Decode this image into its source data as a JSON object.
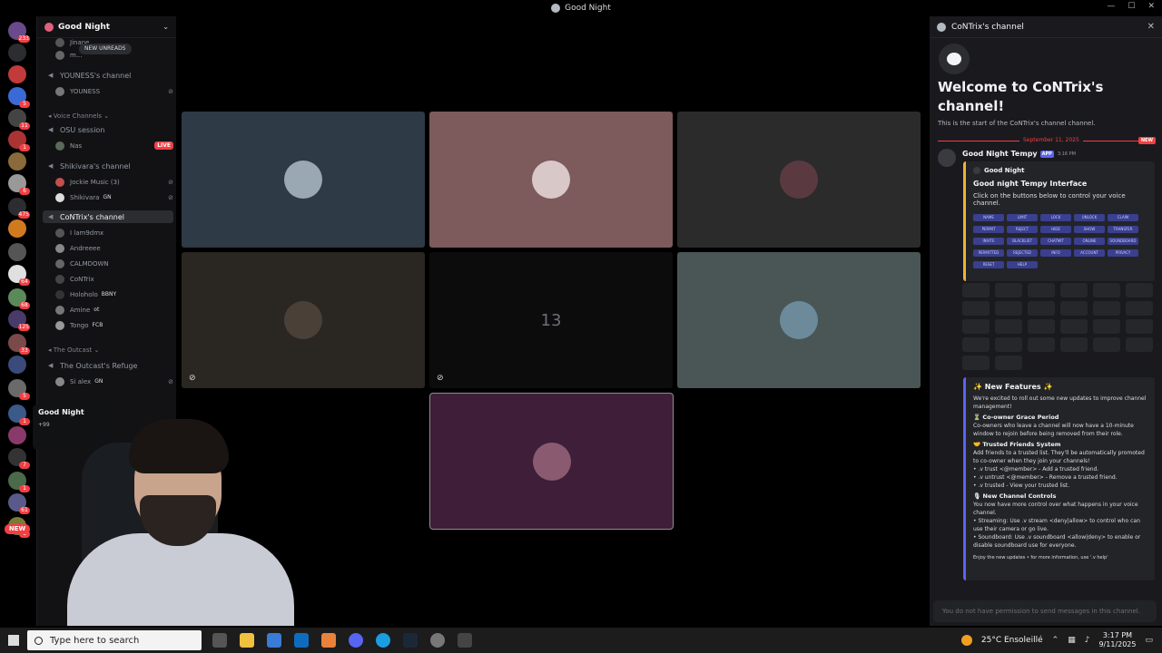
{
  "window": {
    "title": "Good Night"
  },
  "sidebar": {
    "guild_name": "Good Night",
    "new_unreads": "NEW UNREADS",
    "channels": [
      {
        "name": "YOUNESS's channel",
        "members": [
          {
            "name": "YOUNESS",
            "muted": true
          }
        ]
      },
      {
        "category": "Voice Channels"
      },
      {
        "name": "OSU session",
        "members": [
          {
            "name": "Nas",
            "live": "LIVE"
          }
        ]
      },
      {
        "name": "Shikivara's channel",
        "members": [
          {
            "name": "Jockie Music (3)"
          },
          {
            "name": "Shikivara",
            "tag": "GN"
          }
        ]
      },
      {
        "name": "CoNTrix's channel",
        "active": true,
        "members": [
          {
            "name": "I lam9dmx"
          },
          {
            "name": "Andreeee"
          },
          {
            "name": "CALMDOWN"
          },
          {
            "name": "CoNTrix"
          },
          {
            "name": "Holoholo",
            "tag": "BBNY"
          },
          {
            "name": "Amine",
            "tag": "ot"
          },
          {
            "name": "Tongo",
            "tag": "FCB"
          }
        ]
      },
      {
        "category": "The Outcast"
      },
      {
        "name": "The Outcast's Refuge",
        "members": [
          {
            "name": "Si alex",
            "tag": "GN"
          }
        ]
      }
    ],
    "top_members": [
      "Jinane",
      "m..."
    ],
    "popup_title": "Good Night",
    "popup_count": "+99"
  },
  "rail": {
    "badges": [
      "233",
      "5",
      "11",
      "1",
      "6",
      "475",
      "64",
      "68",
      "125",
      "33",
      "5",
      "1",
      "7",
      "1",
      "61",
      "1"
    ],
    "new_label": "NEW"
  },
  "grid": {
    "tiles": [
      {
        "color": "#2e3a45",
        "avatar": "#9aa8b4"
      },
      {
        "color": "#7d5a5c",
        "avatar": "#d8c8c8"
      },
      {
        "color": "#2b2b2b",
        "avatar": "#5a3a40"
      },
      {
        "color": "#2a2722",
        "avatar": "#4a4038",
        "muted": true
      },
      {
        "color": "#0c0c0c",
        "number": "13",
        "muted": true
      },
      {
        "color": "#4a5655",
        "avatar": "#6c8a9a"
      },
      {
        "color": "#3e1e38",
        "avatar": "#8a5a70",
        "selected": true
      }
    ]
  },
  "panel": {
    "title": "CoNTrix's channel",
    "welcome": "Welcome to CoNTrix's channel!",
    "start": "This is the start of the CoNTrix's channel channel.",
    "date": "September 11, 2025",
    "new_badge": "NEW",
    "author": "Good Night Tempy",
    "app_badge": "APP",
    "time": "3:16 PM",
    "embed_author": "Good Night",
    "embed_title": "Good night Tempy Interface",
    "embed_desc": "Click on the buttons below to control your voice channel.",
    "buttons": [
      "NAME",
      "LIMIT",
      "LOCK",
      "UNLOCK",
      "CLAIM",
      "PERMIT",
      "REJECT",
      "HIDE",
      "SHOW",
      "TRANSFER",
      "INVITE",
      "BLACKLIST",
      "CHATMIT",
      "ONLINE",
      "SOUNDBOARD",
      "PERMITTED",
      "REJECTED",
      "INFO",
      "ACCOUNT",
      "PRIVACY",
      "RESET",
      "HELP"
    ],
    "features": {
      "title": "New Features",
      "intro": "We're excited to roll out some new updates to improve channel management!",
      "h1": "Co-owner Grace Period",
      "p1": "Co-owners who leave a channel will now have a 10-minute window to rejoin before being removed from their role.",
      "h2": "Trusted Friends System",
      "p2": "Add friends to a trusted list. They'll be automatically promoted to co-owner when they join your channels!",
      "l1": "• .v trust <@member> - Add a trusted friend.",
      "l2": "• .v untrust <@member> - Remove a trusted friend.",
      "l3": "• .v trusted - View your trusted list.",
      "h3": "New Channel Controls",
      "p3": "You now have more control over what happens in your voice channel.",
      "l4": "• Streaming: Use .v stream <deny|allow> to control who can use their camera or go live.",
      "l5": "• Soundboard: Use .v soundboard <allow|deny> to enable or disable soundboard use for everyone.",
      "footer": "Enjoy the new updates • for more information, use '.v help'"
    },
    "no_permission": "You do not have permission to send messages in this channel."
  },
  "taskbar": {
    "search_placeholder": "Type here to search",
    "weather": "25°C Ensoleillé",
    "time": "3:17 PM",
    "date": "9/11/2025"
  }
}
